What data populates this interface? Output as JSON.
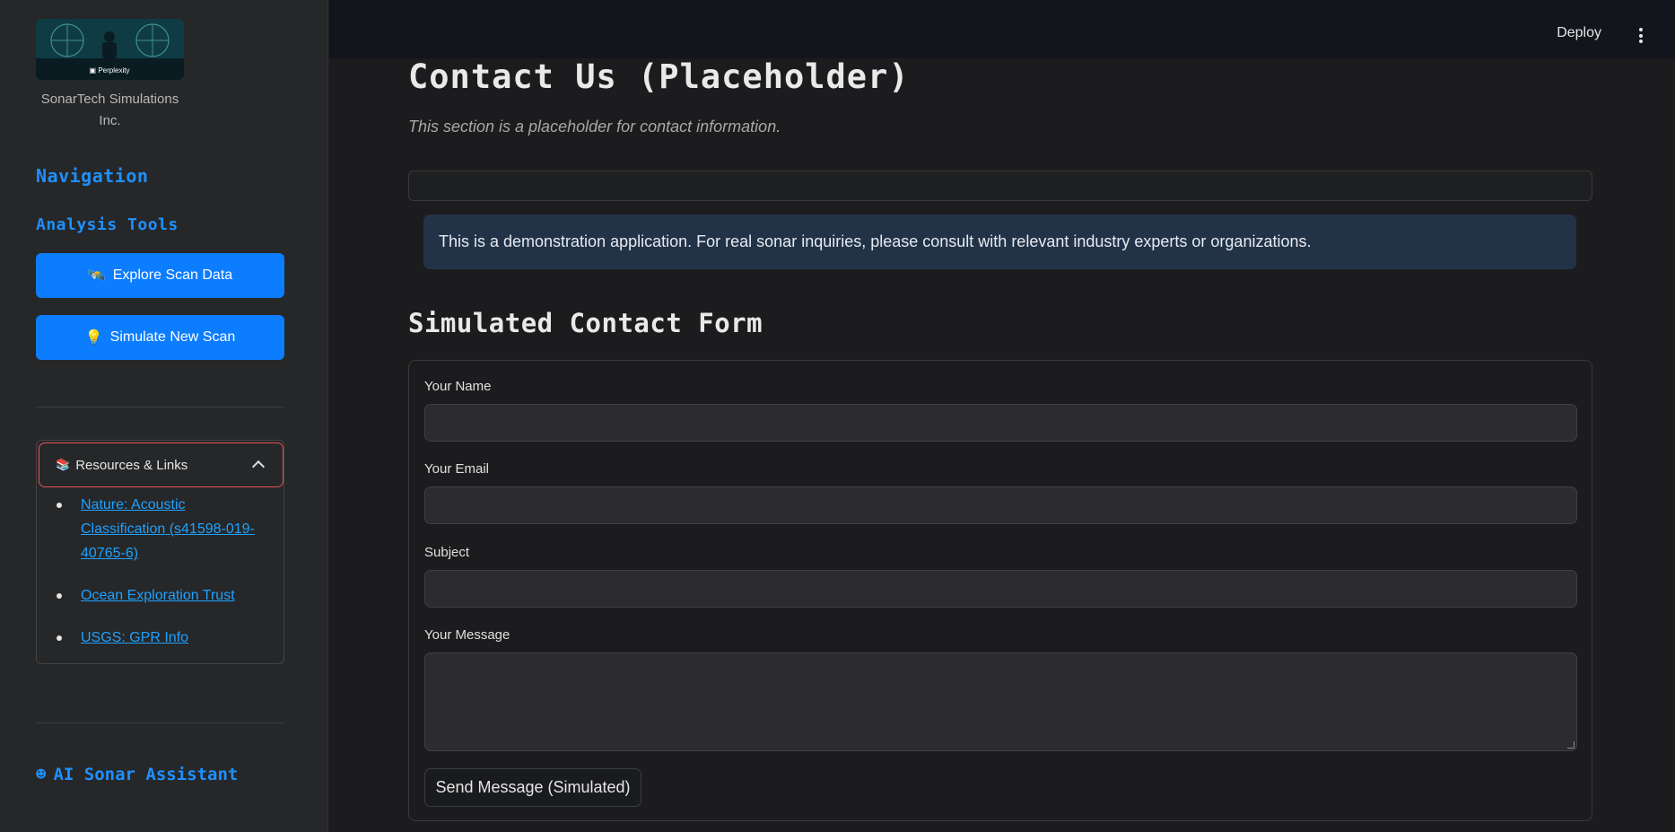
{
  "sidebar": {
    "company_name": "SonarTech Simulations Inc.",
    "logo_label": "Perplexity",
    "navigation_title": "Navigation",
    "analysis_title": "Analysis Tools",
    "buttons": [
      {
        "icon": "🛰️",
        "label": "Explore Scan Data"
      },
      {
        "icon": "💡",
        "label": "Simulate New Scan"
      }
    ],
    "resources": {
      "icon": "📚",
      "title": "Resources & Links",
      "expanded": true,
      "links": [
        {
          "label": "Nature: Acoustic Classification (s41598-019-40765-6)"
        },
        {
          "label": "Ocean Exploration Trust"
        },
        {
          "label": "USGS: GPR Info"
        }
      ]
    },
    "assistant": {
      "icon": "☻",
      "label": "AI Sonar Assistant"
    }
  },
  "header": {
    "deploy_label": "Deploy"
  },
  "main": {
    "title": "Contact Us (Placeholder)",
    "subtitle": "This section is a placeholder for contact information.",
    "info": "This is a demonstration application. For real sonar inquiries, please consult with relevant industry experts or organizations.",
    "form_title": "Simulated Contact Form",
    "fields": {
      "name_label": "Your Name",
      "name_value": "",
      "email_label": "Your Email",
      "email_value": "",
      "subject_label": "Subject",
      "subject_value": "",
      "message_label": "Your Message",
      "message_value": ""
    },
    "submit_label": "Send Message (Simulated)"
  },
  "colors": {
    "accent": "#0d7dff",
    "heading_blue": "#1e90ff",
    "link_blue": "#1ea2ff",
    "background": "#1c1c1e",
    "sidebar_bg": "#262729",
    "info_bg": "#223348",
    "expander_border": "#e0545a"
  }
}
